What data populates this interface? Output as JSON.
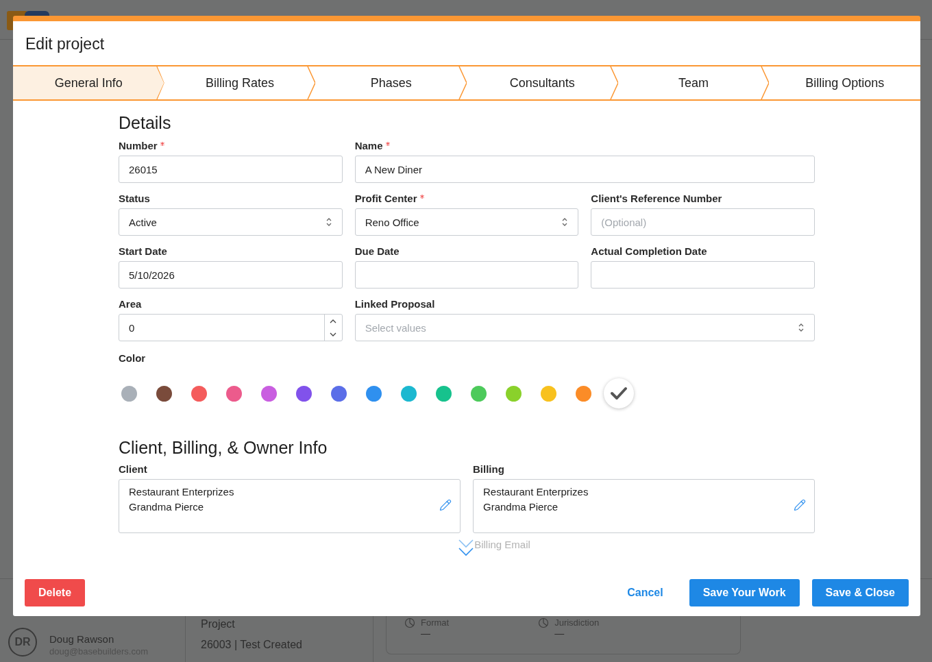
{
  "background": {
    "user": {
      "initials": "DR",
      "name": "Doug Rawson",
      "email": "doug@basebuilders.com"
    },
    "project": {
      "label": "Project",
      "value": "26003 | Test Created"
    },
    "facts": [
      {
        "label": "Format",
        "value": "—"
      },
      {
        "label": "Jurisdiction",
        "value": "—"
      }
    ]
  },
  "modal": {
    "title": "Edit project",
    "steps": [
      {
        "label": "General Info",
        "selected": true
      },
      {
        "label": "Billing Rates",
        "selected": false
      },
      {
        "label": "Phases",
        "selected": false
      },
      {
        "label": "Consultants",
        "selected": false
      },
      {
        "label": "Team",
        "selected": false
      },
      {
        "label": "Billing Options",
        "selected": false
      }
    ],
    "details": {
      "heading": "Details",
      "rows": [
        [
          {
            "label": "Number",
            "required": true,
            "kind": "text",
            "value": "26015"
          },
          {
            "label": "Name",
            "required": true,
            "kind": "text",
            "value": "A New Diner"
          }
        ],
        [
          {
            "label": "Status",
            "required": false,
            "kind": "select",
            "value": "Active"
          },
          {
            "label": "Profit Center",
            "required": true,
            "kind": "select",
            "value": "Reno Office"
          },
          {
            "label": "Client's Reference Number",
            "required": false,
            "kind": "text",
            "placeholder": "(Optional)"
          }
        ],
        [
          {
            "label": "Start Date",
            "required": false,
            "kind": "text",
            "value": "5/10/2026"
          },
          {
            "label": "Due Date",
            "required": false,
            "kind": "text"
          },
          {
            "label": "Actual Completion Date",
            "required": false,
            "kind": "text"
          }
        ],
        [
          {
            "label": "Area",
            "required": false,
            "kind": "number",
            "value": "0"
          },
          {
            "label": "Linked Proposal",
            "required": false,
            "kind": "select",
            "placeholder": "Select values"
          }
        ]
      ],
      "color_label": "Color",
      "colors": [
        {
          "color": "#a9b0b8",
          "selected": false
        },
        {
          "color": "#7a4b3b",
          "selected": false
        },
        {
          "color": "#f45c5c",
          "selected": false
        },
        {
          "color": "#ec5b8c",
          "selected": false
        },
        {
          "color": "#c95ee0",
          "selected": false
        },
        {
          "color": "#8152eb",
          "selected": false
        },
        {
          "color": "#5b6ee8",
          "selected": false
        },
        {
          "color": "#2f90ef",
          "selected": false
        },
        {
          "color": "#1cb8d0",
          "selected": false
        },
        {
          "color": "#17c28d",
          "selected": false
        },
        {
          "color": "#4dca5b",
          "selected": false
        },
        {
          "color": "#8ad12b",
          "selected": false
        },
        {
          "color": "#f8c11e",
          "selected": false
        },
        {
          "color": "#fb8c27",
          "selected": false
        },
        {
          "color": "#ffffff",
          "selected": true
        }
      ]
    },
    "client_section": {
      "heading": "Client, Billing, & Owner Info",
      "cards": [
        {
          "label": "Client",
          "lines": [
            "Restaurant Enterprizes",
            "Grandma Pierce"
          ]
        },
        {
          "label": "Billing",
          "lines": [
            "Restaurant Enterprizes",
            "Grandma Pierce"
          ]
        }
      ],
      "next_label": "Billing Email"
    },
    "buttons": {
      "delete": "Delete",
      "cancel": "Cancel",
      "save": "Save Your Work",
      "save_close": "Save & Close"
    }
  }
}
